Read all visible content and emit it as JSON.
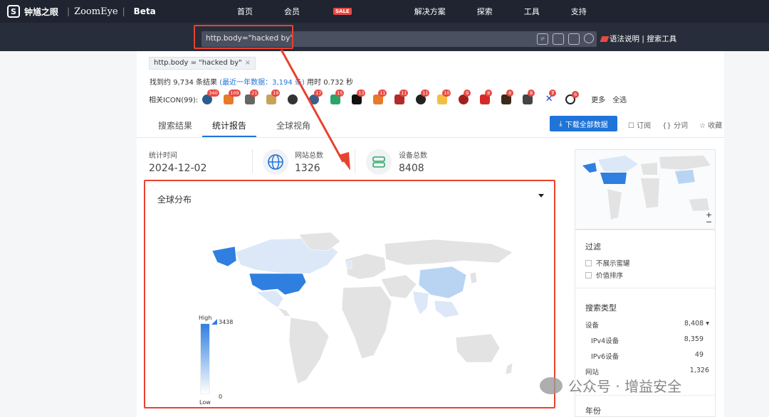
{
  "brand": {
    "cn_name": "钟馗之眼",
    "en_name": "ZoomEye",
    "beta": "Beta"
  },
  "nav": {
    "items": [
      "首页",
      "会员",
      "解决方案",
      "探索",
      "工具",
      "支持"
    ],
    "sale_badge": "SALE"
  },
  "search": {
    "query": "http.body=\"hacked by\"",
    "syntax_link": "语法说明 | 搜索工具"
  },
  "filter_chip": "http.body = \"hacked by\"",
  "result_stats": {
    "prefix": "找到约",
    "count": "9,734",
    "unit": "条结果",
    "recent_label": "(最近一年数据：",
    "recent_count": "3,194",
    "recent_unit": "条)",
    "time": "用时 0.732 秒"
  },
  "related_icons": {
    "label": "相关ICON(99):",
    "counts": [
      "340",
      "109",
      "21",
      "19",
      "",
      "17",
      "15",
      "13",
      "11",
      "11",
      "11",
      "10",
      "9",
      "8",
      "8",
      "8",
      "7",
      "6"
    ],
    "more": "更多",
    "select_all": "全选"
  },
  "tabs": [
    "搜索结果",
    "统计报告",
    "全球视角"
  ],
  "active_tab": 1,
  "download_button": "下载全部数据",
  "actions": [
    "订阅",
    "分词",
    "收藏"
  ],
  "summary": [
    {
      "label": "统计时间",
      "value": "2024-12-02"
    },
    {
      "label": "网站总数",
      "value": "1326"
    },
    {
      "label": "设备总数",
      "value": "8408"
    }
  ],
  "map": {
    "title": "全球分布",
    "legend_high": "High",
    "legend_low": "Low",
    "max": "3438",
    "min": "0",
    "accent": "#2f7fe0"
  },
  "filter": {
    "title": "过滤",
    "options": [
      "不展示蜜罐",
      "价值排序"
    ]
  },
  "search_type": {
    "title": "搜索类型",
    "rows": [
      {
        "label": "设备",
        "value": "8,408 ▾"
      },
      {
        "label": "IPv4设备",
        "value": "8,359"
      },
      {
        "label": "IPv6设备",
        "value": "49"
      },
      {
        "label": "网站",
        "value": "1,326"
      }
    ]
  },
  "year_title": "年份",
  "zoom": {
    "plus": "+",
    "minus": "−"
  },
  "watermark": "公众号 · 增益安全"
}
